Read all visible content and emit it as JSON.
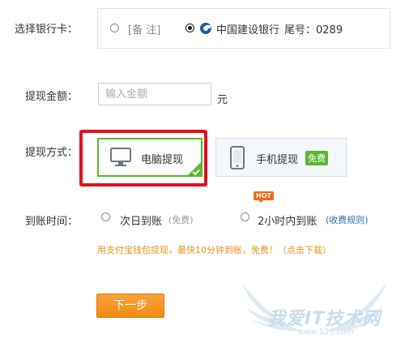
{
  "bank": {
    "label": "选择银行卡：",
    "note_option": "[备 注]",
    "selected_bank": "中国建设银行",
    "tail_label": "尾号：0289"
  },
  "amount": {
    "label": "提现金额：",
    "placeholder": "输入金额",
    "unit": "元"
  },
  "method": {
    "label": "提现方式：",
    "pc_label": "电脑提现",
    "mobile_label": "手机提现",
    "free_badge": "免费"
  },
  "arrival": {
    "label": "到账时间：",
    "next_day": "次日到账",
    "next_day_note": "(免费)",
    "two_hours": "2小时内到账",
    "fee_rules_link": "(收费规则)",
    "hot_tag": "HOT"
  },
  "promo_text": "用支付宝钱包提现，最快10分钟到账，免费！（点击下载）",
  "next_button": "下一步",
  "watermark": {
    "title": "我爱IT技术网",
    "url": "www.52ij.com"
  },
  "colors": {
    "selected_border": "#5fb82e",
    "highlight_frame": "#e3101b",
    "button": "#f18a0f",
    "promo": "#f0921a",
    "link": "#2d6fb7"
  }
}
